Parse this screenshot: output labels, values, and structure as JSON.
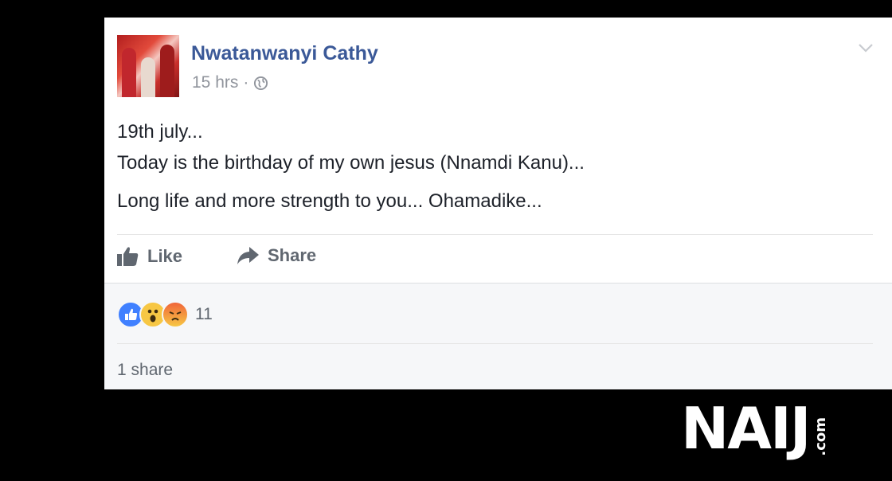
{
  "post": {
    "author": "Nwatanwanyi Cathy",
    "time": "15 hrs",
    "separator": "·",
    "privacy_icon": "globe-icon",
    "lines": [
      "19th july...",
      "Today is the birthday of my own jesus (Nnamdi Kanu)...",
      "Long life and more strength to you... Ohamadike..."
    ]
  },
  "actions": {
    "like_label": "Like",
    "share_label": "Share"
  },
  "footer": {
    "reactions": [
      "like-reaction",
      "wow-reaction",
      "angry-reaction"
    ],
    "reaction_count": "11",
    "shares_text": "1 share"
  },
  "watermark": {
    "word": "NAIJ",
    "domain": ".com"
  },
  "colors": {
    "author": "#3b5998",
    "like_blue": "#4080ff",
    "wow_yellow": "#f7c744",
    "angry_orange": "#f0653a"
  }
}
